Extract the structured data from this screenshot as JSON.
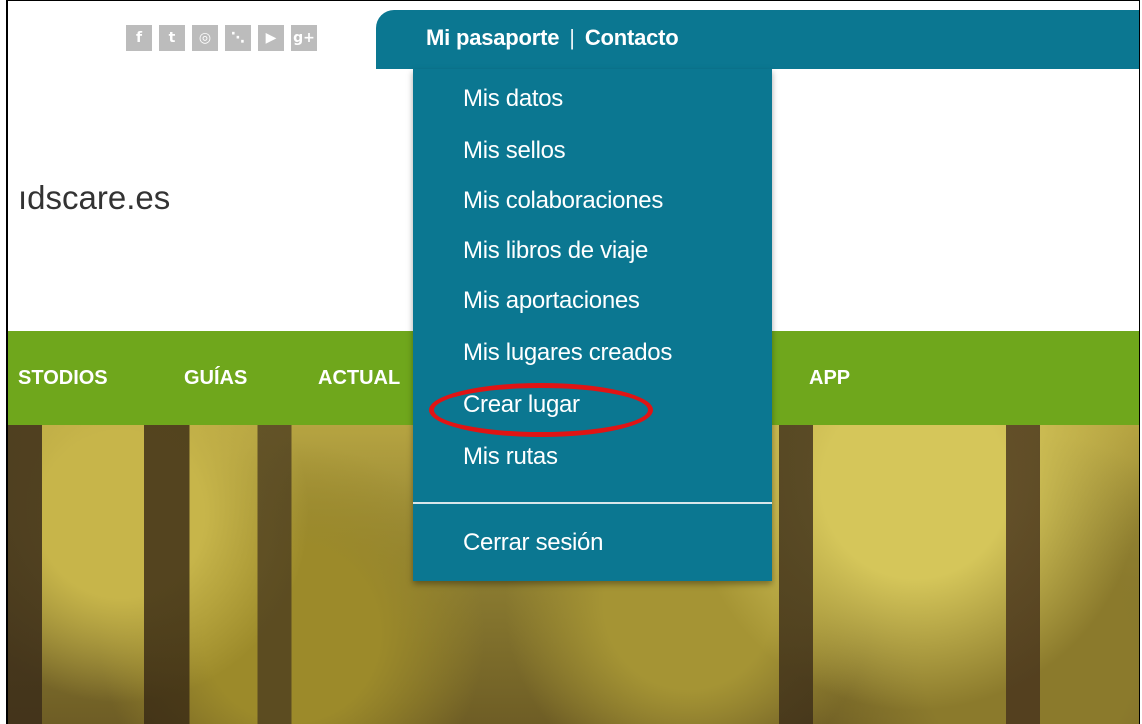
{
  "social": {
    "icons": [
      {
        "name": "facebook-icon",
        "glyph": "f"
      },
      {
        "name": "twitter-icon",
        "glyph": "t"
      },
      {
        "name": "instagram-icon",
        "glyph": "◎"
      },
      {
        "name": "rss-icon",
        "glyph": "⋱"
      },
      {
        "name": "youtube-icon",
        "glyph": "▶"
      },
      {
        "name": "google-plus-icon",
        "glyph": "g+"
      }
    ]
  },
  "header": {
    "my_passport": "Mi pasaporte",
    "separator": "|",
    "contact": "Contacto",
    "site_name": "ıdscare.es"
  },
  "nav": {
    "items": [
      "STODIOS",
      "GUÍAS",
      "ACTUAL",
      "APP"
    ]
  },
  "dropdown": {
    "items": [
      "Mis datos",
      "Mis sellos",
      "Mis colaboraciones",
      "Mis libros de viaje",
      "Mis aportaciones",
      "Mis lugares creados",
      "Crear lugar",
      "Mis rutas"
    ],
    "logout": "Cerrar sesión"
  },
  "colors": {
    "header_blue": "#0b7791",
    "nav_green": "#6fa71c",
    "highlight_red": "#e01414"
  }
}
